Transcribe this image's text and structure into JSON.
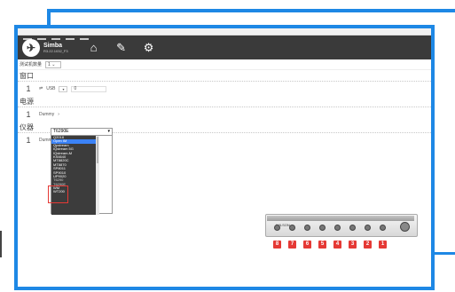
{
  "app": {
    "name": "Simba",
    "version": "R3.22.1032_F3"
  },
  "config": {
    "label": "测试机数量",
    "value": "1",
    "caret": "⌄"
  },
  "sections": {
    "port": {
      "title": "窗口",
      "row": {
        "index": "1",
        "type": "USB",
        "value": "0"
      }
    },
    "power": {
      "title": "电源",
      "row": {
        "index": "1",
        "value": "Dummy"
      }
    },
    "instrument": {
      "title": "仪器",
      "row": {
        "index": "1",
        "value": "Dummy"
      }
    }
  },
  "dropdown": {
    "selected": "T6290E",
    "items": [
      "Q2018",
      "Open IM",
      "Qpstream",
      "IQstream 5G",
      "IQstream-M",
      "KS6640",
      "MT8820C",
      "MT8870",
      "SP8011",
      "SP9010",
      "UP9020",
      "T6290",
      "T6290E",
      "WM",
      "WT200"
    ],
    "selected_index": 1,
    "highlighted_items": [
      "T6290",
      "T6290E"
    ]
  },
  "device": {
    "label": "WILSON",
    "port_numbers": [
      "8",
      "7",
      "6",
      "5",
      "4",
      "3",
      "2",
      "1"
    ]
  },
  "colors": {
    "accent": "#1e88e5",
    "header": "#3a3a3a",
    "highlight": "#e53935"
  }
}
